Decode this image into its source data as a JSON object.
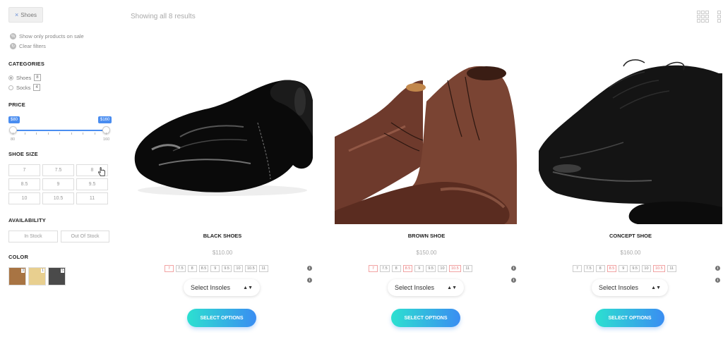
{
  "filter_chip": {
    "close": "×",
    "label": "Shoes"
  },
  "sale_option": "Show only products on sale",
  "clear_filters": "Clear filters",
  "categories": {
    "heading": "CATEGORIES",
    "items": [
      {
        "label": "Shoes",
        "count": "8",
        "selected": true
      },
      {
        "label": "Socks",
        "count": "4",
        "selected": false
      }
    ]
  },
  "price": {
    "heading": "PRICE",
    "min_tag": "$80",
    "max_tag": "$160",
    "min_label": "80",
    "max_label": "160"
  },
  "shoe_size": {
    "heading": "SHOE SIZE",
    "sizes": [
      "7",
      "7.5",
      "8",
      "8.5",
      "9",
      "9.5",
      "10",
      "10.5",
      "11"
    ]
  },
  "availability": {
    "heading": "AVAILABILITY",
    "in_stock": "In Stock",
    "out_of_stock": "Out Of Stock"
  },
  "color": {
    "heading": "COLOR",
    "swatches": [
      {
        "hex": "#a87443",
        "count": "3"
      },
      {
        "hex": "#e8cf8f",
        "count": "1"
      },
      {
        "hex": "#4a4a4a",
        "count": "5"
      }
    ]
  },
  "results_text": "Showing all 8 results",
  "products": [
    {
      "name": "BLACK SHOES",
      "price": "$110.00",
      "sizes": [
        {
          "v": "7",
          "red": true
        },
        {
          "v": "7.5",
          "red": false
        },
        {
          "v": "8",
          "red": false
        },
        {
          "v": "8.5",
          "red": false
        },
        {
          "v": "9",
          "red": false
        },
        {
          "v": "9.5",
          "red": false
        },
        {
          "v": "10",
          "red": false
        },
        {
          "v": "10.5",
          "red": false
        },
        {
          "v": "11",
          "red": false
        }
      ],
      "insoles": "Select Insoles",
      "button": "SELECT OPTIONS"
    },
    {
      "name": "BROWN SHOE",
      "price": "$150.00",
      "sizes": [
        {
          "v": "7",
          "red": true
        },
        {
          "v": "7.5",
          "red": false
        },
        {
          "v": "8",
          "red": false
        },
        {
          "v": "8.5",
          "red": true
        },
        {
          "v": "9",
          "red": false
        },
        {
          "v": "9.5",
          "red": false
        },
        {
          "v": "10",
          "red": false
        },
        {
          "v": "10.5",
          "red": true
        },
        {
          "v": "11",
          "red": false
        }
      ],
      "insoles": "Select Insoles",
      "button": "SELECT OPTIONS"
    },
    {
      "name": "CONCEPT SHOE",
      "price": "$160.00",
      "sizes": [
        {
          "v": "7",
          "red": false
        },
        {
          "v": "7.5",
          "red": false
        },
        {
          "v": "8",
          "red": false
        },
        {
          "v": "8.5",
          "red": true
        },
        {
          "v": "9",
          "red": false
        },
        {
          "v": "9.5",
          "red": false
        },
        {
          "v": "10",
          "red": false
        },
        {
          "v": "10.5",
          "red": true
        },
        {
          "v": "11",
          "red": false
        }
      ],
      "insoles": "Select Insoles",
      "button": "SELECT OPTIONS"
    }
  ]
}
